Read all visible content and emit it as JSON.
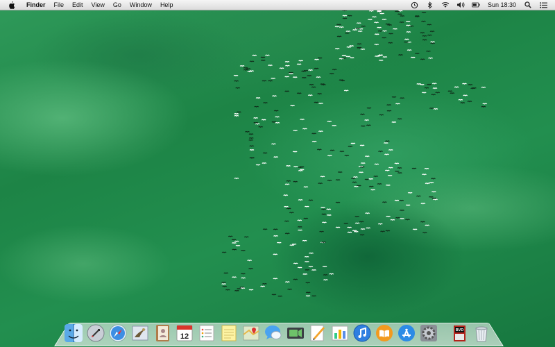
{
  "menubar": {
    "app_name": "Finder",
    "items": [
      "File",
      "Edit",
      "View",
      "Go",
      "Window",
      "Help"
    ],
    "status_icons": [
      "time-machine-icon",
      "bluetooth-icon",
      "wifi-icon",
      "volume-icon",
      "battery-icon"
    ],
    "clock": "Sun 18:30",
    "spotlight_icon": "spotlight-icon",
    "notification_icon": "notification-center-icon"
  },
  "dock": {
    "apps": [
      {
        "name": "Finder",
        "icon": "finder-icon"
      },
      {
        "name": "Launchpad",
        "icon": "launchpad-icon"
      },
      {
        "name": "Safari",
        "icon": "safari-icon"
      },
      {
        "name": "Mail",
        "icon": "mail-icon"
      },
      {
        "name": "Contacts",
        "icon": "contacts-icon"
      },
      {
        "name": "Calendar",
        "icon": "calendar-icon",
        "label": "12"
      },
      {
        "name": "Reminders",
        "icon": "reminders-icon"
      },
      {
        "name": "Notes",
        "icon": "notes-icon"
      },
      {
        "name": "Maps",
        "icon": "maps-icon"
      },
      {
        "name": "Messages",
        "icon": "messages-icon"
      },
      {
        "name": "FaceTime",
        "icon": "facetime-icon"
      },
      {
        "name": "Pages",
        "icon": "pages-icon"
      },
      {
        "name": "Numbers",
        "icon": "numbers-icon"
      },
      {
        "name": "iTunes",
        "icon": "itunes-icon"
      },
      {
        "name": "iBooks",
        "icon": "ibooks-icon"
      },
      {
        "name": "App Store",
        "icon": "app-store-icon"
      },
      {
        "name": "System Preferences",
        "icon": "system-preferences-icon"
      }
    ],
    "right_items": [
      {
        "name": "Document",
        "icon": "document-stack-icon",
        "label": "BVD"
      },
      {
        "name": "Trash",
        "icon": "trash-icon"
      }
    ]
  },
  "colors": {
    "wallpaper": "#1f8a4a",
    "menubar": "#e9e9e9"
  }
}
